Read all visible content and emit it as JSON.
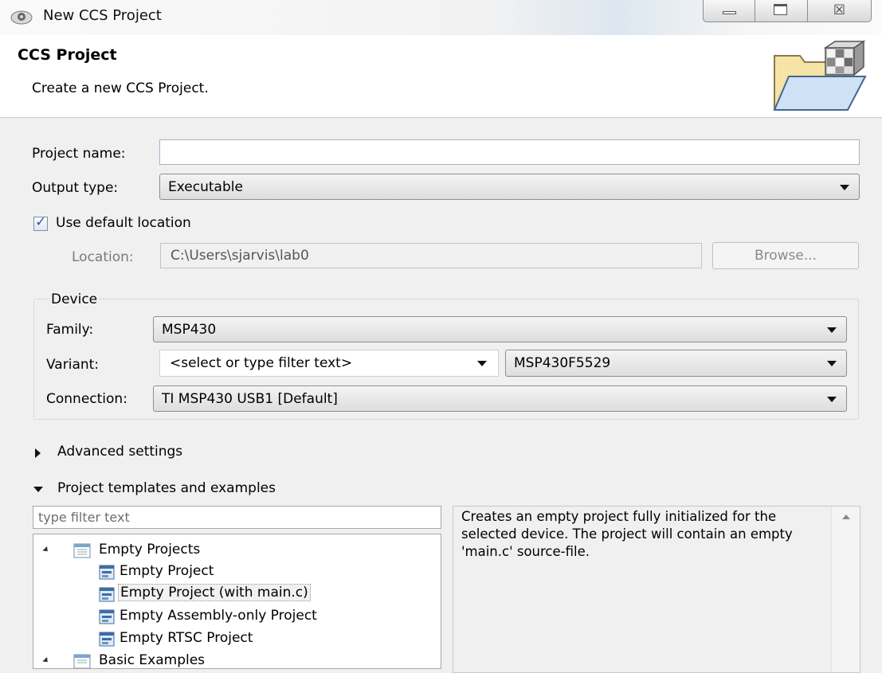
{
  "window": {
    "title": "New CCS Project",
    "minimize_glyph": "",
    "close_glyph": "☒"
  },
  "header": {
    "title": "CCS Project",
    "description": "Create a new CCS Project."
  },
  "form": {
    "project_name_label": "Project name:",
    "project_name_value": "",
    "output_type_label": "Output type:",
    "output_type_value": "Executable",
    "use_default_location_label": "Use default location",
    "use_default_location_checked": true,
    "location_label": "Location:",
    "location_value": "C:\\Users\\sjarvis\\lab0",
    "browse_label": "Browse..."
  },
  "device": {
    "group_label": "Device",
    "family_label": "Family:",
    "family_value": "MSP430",
    "variant_label": "Variant:",
    "variant_filter_value": "<select or type filter text>",
    "variant_value": "MSP430F5529",
    "connection_label": "Connection:",
    "connection_value": "TI MSP430 USB1 [Default]"
  },
  "advanced": {
    "label": "Advanced settings"
  },
  "templates": {
    "label": "Project templates and examples",
    "filter_placeholder": "type filter text",
    "tree": [
      {
        "label": "Empty Projects",
        "type": "folder",
        "expanded": true
      },
      {
        "label": "Empty Project",
        "type": "project"
      },
      {
        "label": "Empty Project (with main.c)",
        "type": "project",
        "selected": true
      },
      {
        "label": "Empty Assembly-only Project",
        "type": "project"
      },
      {
        "label": "Empty RTSC Project",
        "type": "project"
      },
      {
        "label": "Basic Examples",
        "type": "folder",
        "expanded": true
      }
    ],
    "description": "Creates an empty project fully initialized for the selected device. The project will contain an empty 'main.c' source-file."
  },
  "colors": {
    "field_border": "#9fb5cb",
    "selection_fill": "#f1f1f1",
    "check_mark": "#2a54a8"
  }
}
